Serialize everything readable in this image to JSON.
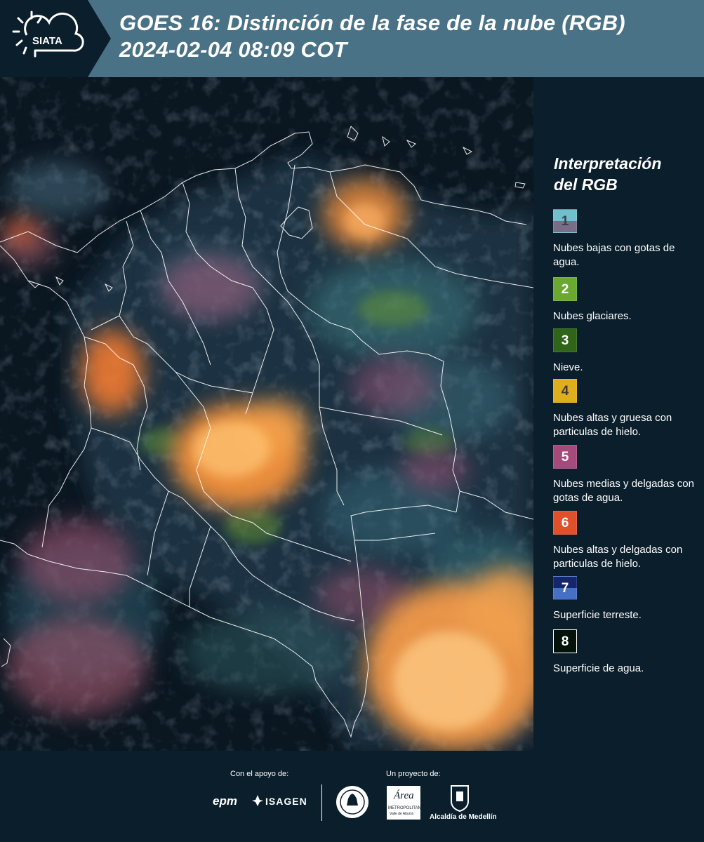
{
  "header": {
    "logo_text": "SIATA",
    "title_line1": "GOES 16: Distinción de la fase de la nube (RGB)",
    "title_line2": " 2024-02-04 08:09 COT",
    "colors": {
      "header_bg": "#4a7286",
      "logo_bg": "#0b1e2b"
    }
  },
  "legend": {
    "title_line1": "Interpretación",
    "title_line2": "del RGB",
    "items": [
      {
        "number": "1",
        "label": "Nubes bajas con gotas de agua.",
        "color_top": "#6fbfcc",
        "color_bottom": "#7a6d88",
        "number_color": "#3d3d4d"
      },
      {
        "number": "2",
        "label": "Nubes glaciares.",
        "color_top": "#6aa832",
        "color_bottom": "#6aa832",
        "number_color": "#ffffff"
      },
      {
        "number": "3",
        "label": "Nieve.",
        "color_top": "#2f6419",
        "color_bottom": "#2f6419",
        "number_color": "#ffffff"
      },
      {
        "number": "4",
        "label": "Nubes altas y gruesa con particulas de hielo.",
        "color_top": "#e0ae1c",
        "color_bottom": "#e0ae1c",
        "number_color": "#3a3a3a"
      },
      {
        "number": "5",
        "label": "Nubes medias y delgadas con gotas de agua.",
        "color_top": "#a54b7c",
        "color_bottom": "#a54b7c",
        "number_color": "#ffffff"
      },
      {
        "number": "6",
        "label": "Nubes altas y delgadas con particulas de hielo.",
        "color_top": "#e0502a",
        "color_bottom": "#e0502a",
        "number_color": "#ffffff"
      },
      {
        "number": "7",
        "label": "Superficie terreste.",
        "color_top": "#15266a",
        "color_bottom": "#4470c6",
        "number_color": "#ffffff"
      },
      {
        "number": "8",
        "label": "Superficie de agua.",
        "color_top": "#05120a",
        "color_bottom": "#05120a",
        "number_color": "#ffffff"
      }
    ]
  },
  "footer": {
    "support_label": "Con el apoyo de:",
    "project_label": "Un proyecto de:",
    "sponsor1": "epm",
    "sponsor2": "ISAGEN",
    "partner_area_line1": "Área",
    "partner_area_line2": "METROPOLITANA",
    "partner_area_line3": "Valle de Aburrá",
    "partner_alcaldia": "Alcaldía de Medellín"
  }
}
